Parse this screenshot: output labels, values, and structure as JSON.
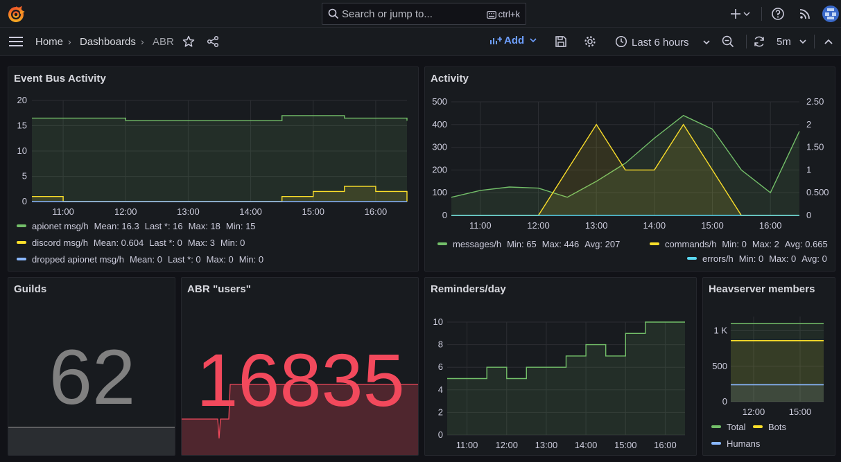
{
  "topbar": {
    "search_placeholder": "Search or jump to...",
    "search_shortcut": "ctrl+k"
  },
  "nav": {
    "breadcrumb": [
      "Home",
      "Dashboards",
      "ABR"
    ],
    "add_label": "Add",
    "time_range": "Last 6 hours",
    "refresh_interval": "5m"
  },
  "colors": {
    "green": "#73bf69",
    "yellow": "#fade2a",
    "blue": "#8ab8ff",
    "cyan": "#5ad8f0",
    "red": "#f2495c",
    "gray": "#808080"
  },
  "panels": {
    "event_bus": {
      "title": "Event Bus Activity",
      "legend": [
        {
          "name": "apionet msg/h",
          "stats": [
            "Mean: 16.3",
            "Last *: 16",
            "Max: 18",
            "Min: 15"
          ]
        },
        {
          "name": "discord msg/h",
          "stats": [
            "Mean: 0.604",
            "Last *: 0",
            "Max: 3",
            "Min: 0"
          ]
        },
        {
          "name": "dropped apionet msg/h",
          "stats": [
            "Mean: 0",
            "Last *: 0",
            "Max: 0",
            "Min: 0"
          ]
        }
      ]
    },
    "activity": {
      "title": "Activity",
      "legend": [
        {
          "name": "messages/h",
          "stats": [
            "Min: 65",
            "Max: 446",
            "Avg: 207"
          ]
        },
        {
          "name": "commands/h",
          "stats": [
            "Min: 0",
            "Max: 2",
            "Avg: 0.665"
          ]
        },
        {
          "name": "errors/h",
          "stats": [
            "Min: 0",
            "Max: 0",
            "Avg: 0"
          ]
        }
      ]
    },
    "guilds": {
      "title": "Guilds",
      "value": "62"
    },
    "abr_users": {
      "title": "ABR \"users\"",
      "value": "16835"
    },
    "reminders": {
      "title": "Reminders/day"
    },
    "heavserver": {
      "title": "Heavserver members",
      "legend": [
        {
          "name": "Total"
        },
        {
          "name": "Bots"
        },
        {
          "name": "Humans"
        }
      ]
    }
  },
  "chart_data": [
    {
      "type": "line",
      "panel": "Event Bus Activity",
      "x": [
        "10:30",
        "11:00",
        "11:30",
        "12:00",
        "12:30",
        "13:00",
        "13:30",
        "14:00",
        "14:30",
        "15:00",
        "15:30",
        "16:00",
        "16:30"
      ],
      "x_ticks": [
        "11:00",
        "12:00",
        "13:00",
        "14:00",
        "15:00",
        "16:00"
      ],
      "y_ticks": [
        0,
        5,
        10,
        15,
        20
      ],
      "ylim": [
        0,
        20
      ],
      "series": [
        {
          "name": "apionet msg/h",
          "values": [
            16.5,
            16.5,
            16.5,
            16,
            16,
            16,
            16,
            16,
            17,
            17,
            16.5,
            16.5,
            16
          ]
        },
        {
          "name": "discord msg/h",
          "values": [
            1,
            0,
            0,
            0,
            0,
            0,
            0,
            0,
            1,
            2,
            3,
            2,
            0
          ]
        },
        {
          "name": "dropped apionet msg/h",
          "values": [
            0,
            0,
            0,
            0,
            0,
            0,
            0,
            0,
            0,
            0,
            0,
            0,
            0
          ]
        }
      ]
    },
    {
      "type": "line",
      "panel": "Activity",
      "x": [
        "10:30",
        "11:00",
        "11:30",
        "12:00",
        "12:30",
        "13:00",
        "13:30",
        "14:00",
        "14:30",
        "15:00",
        "15:30",
        "16:00",
        "16:30"
      ],
      "x_ticks": [
        "11:00",
        "12:00",
        "13:00",
        "14:00",
        "15:00",
        "16:00"
      ],
      "y_left_ticks": [
        0,
        100,
        200,
        300,
        400,
        500
      ],
      "y_right_ticks": [
        "0",
        "0.500",
        "1",
        "1.50",
        "2",
        "2.50"
      ],
      "ylim_left": [
        0,
        500
      ],
      "ylim_right": [
        0,
        2.5
      ],
      "series": [
        {
          "name": "messages/h",
          "axis": "left",
          "values": [
            80,
            110,
            125,
            120,
            80,
            150,
            230,
            340,
            440,
            380,
            200,
            100,
            370
          ]
        },
        {
          "name": "commands/h",
          "axis": "right",
          "values": [
            0,
            0,
            0,
            0,
            1,
            2,
            1,
            1,
            2,
            1,
            0,
            0,
            0
          ]
        },
        {
          "name": "errors/h",
          "axis": "right",
          "values": [
            0,
            0,
            0,
            0,
            0,
            0,
            0,
            0,
            0,
            0,
            0,
            0,
            0
          ]
        }
      ]
    },
    {
      "type": "line",
      "panel": "Reminders/day",
      "x": [
        "10:30",
        "11:00",
        "11:30",
        "12:00",
        "12:30",
        "13:00",
        "13:30",
        "14:00",
        "14:30",
        "15:00",
        "15:30",
        "16:00",
        "16:30"
      ],
      "x_ticks": [
        "11:00",
        "12:00",
        "13:00",
        "14:00",
        "15:00",
        "16:00"
      ],
      "y_ticks": [
        0,
        2,
        4,
        6,
        8,
        10
      ],
      "ylim": [
        0,
        10
      ],
      "series": [
        {
          "name": "Reminders/day",
          "values": [
            5,
            5,
            6,
            5,
            6,
            6,
            7,
            8,
            7,
            9,
            10,
            10,
            10
          ]
        }
      ]
    },
    {
      "type": "line",
      "panel": "Heavserver members",
      "x_ticks": [
        "12:00",
        "15:00"
      ],
      "y_ticks": [
        "0",
        "500",
        "1 K"
      ],
      "ylim": [
        0,
        1200
      ],
      "series": [
        {
          "name": "Total",
          "values": [
            1100,
            1100
          ]
        },
        {
          "name": "Bots",
          "values": [
            860,
            860
          ]
        },
        {
          "name": "Humans",
          "values": [
            240,
            240
          ]
        }
      ]
    }
  ]
}
